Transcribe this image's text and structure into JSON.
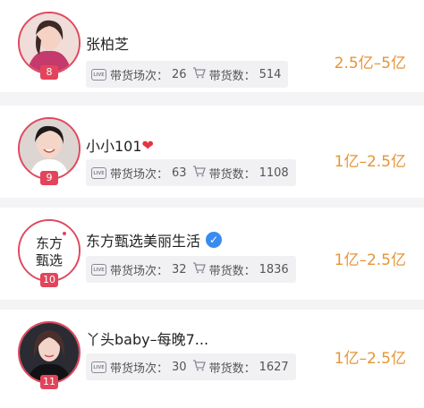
{
  "list": [
    {
      "rank": "8",
      "name": "张柏芝",
      "sessions_label": "带货场次：",
      "sessions": "26",
      "items_label": "带货数：",
      "items": "514",
      "range": "2.5亿–5亿",
      "avatar_bg": "#c53a6f"
    },
    {
      "rank": "9",
      "name": "小小101",
      "name_suffix": "❤",
      "sessions_label": "带货场次：",
      "sessions": "63",
      "items_label": "带货数：",
      "items": "1108",
      "range": "1亿–2.5亿",
      "avatar_bg": "#d8d2cf"
    },
    {
      "rank": "10",
      "name": "东方甄选美丽生活",
      "sessions_label": "带货场次：",
      "sessions": "32",
      "items_label": "带货数：",
      "items": "1836",
      "range": "1亿–2.5亿",
      "avatar_text_1": "东方",
      "avatar_text_2": "甄选",
      "avatar_bg": "#ffffff"
    },
    {
      "rank": "11",
      "name": "丫头baby–每晚7...",
      "sessions_label": "带货场次：",
      "sessions": "30",
      "items_label": "带货数：",
      "items": "1627",
      "range": "1亿–2.5亿",
      "avatar_bg": "#2b2b33"
    }
  ],
  "colors": {
    "accent_red": "#e2455b",
    "range_orange": "#e69434",
    "verified_blue": "#3a8bf0"
  },
  "icons": {
    "live": "live-icon",
    "cart": "cart-icon",
    "verified": "verified-icon",
    "heart": "heart-icon"
  }
}
